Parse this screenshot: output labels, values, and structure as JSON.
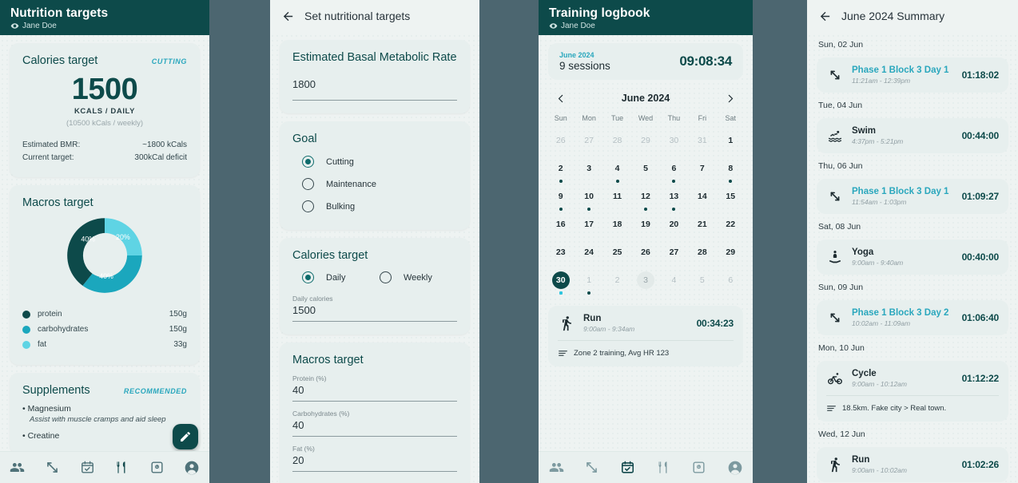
{
  "panel1": {
    "header": {
      "title": "Nutrition targets",
      "user": "Jane Doe",
      "eye_icon": "eye-icon"
    },
    "calories_card": {
      "title": "Calories target",
      "tag": "CUTTING",
      "value": "1500",
      "unit": "KCALS / DAILY",
      "weekly": "(10500 kCals / weekly)",
      "rows": [
        {
          "label": "Estimated BMR:",
          "value": "~1800 kCals"
        },
        {
          "label": "Current target:",
          "value": "300kCal deficit"
        }
      ]
    },
    "macros_card": {
      "title": "Macros target",
      "legend": [
        {
          "name": "protein",
          "value": "150g",
          "color": "#0d4a4a"
        },
        {
          "name": "carbohydrates",
          "value": "150g",
          "color": "#1ba7bd"
        },
        {
          "name": "fat",
          "value": "33g",
          "color": "#5fd4e4"
        }
      ]
    },
    "supplements_card": {
      "title": "Supplements",
      "tag": "RECOMMENDED",
      "items": [
        {
          "name": "Magnesium",
          "desc": "Assist with muscle cramps and aid sleep"
        },
        {
          "name": "Creatine",
          "desc": ""
        }
      ]
    },
    "fab": {
      "icon": "pencil-icon",
      "label": "Edit"
    },
    "nav": [
      {
        "icon": "people-icon",
        "name": "clients",
        "active": false
      },
      {
        "icon": "resize-arrows-icon",
        "name": "measurements",
        "active": false
      },
      {
        "icon": "calendar-check-icon",
        "name": "training",
        "active": false
      },
      {
        "icon": "cutlery-icon",
        "name": "nutrition",
        "active": true
      },
      {
        "icon": "scale-icon",
        "name": "weight",
        "active": false
      },
      {
        "icon": "account-icon",
        "name": "profile",
        "active": false
      }
    ]
  },
  "panel2": {
    "header": {
      "title": "Set nutritional targets",
      "back_icon": "back-arrow-icon"
    },
    "bmr_card": {
      "title": "Estimated Basal Metabolic Rate",
      "value": "1800"
    },
    "goal_card": {
      "title": "Goal",
      "options": [
        {
          "label": "Cutting",
          "selected": true
        },
        {
          "label": "Maintenance",
          "selected": false
        },
        {
          "label": "Bulking",
          "selected": false
        }
      ]
    },
    "calories_card": {
      "title": "Calories target",
      "options": [
        {
          "label": "Daily",
          "selected": true
        },
        {
          "label": "Weekly",
          "selected": false
        }
      ],
      "field_label": "Daily calories",
      "field_value": "1500"
    },
    "macros_card": {
      "title": "Macros target",
      "fields": [
        {
          "label": "Protein (%)",
          "value": "40"
        },
        {
          "label": "Carbohydrates (%)",
          "value": "40"
        },
        {
          "label": "Fat (%)",
          "value": "20"
        }
      ]
    }
  },
  "panel3": {
    "header": {
      "title": "Training logbook",
      "user": "Jane Doe",
      "eye_icon": "eye-icon"
    },
    "summary": {
      "month": "June 2024",
      "sessions": "9 sessions",
      "total_time": "09:08:34"
    },
    "calendar": {
      "month_label": "June 2024",
      "prev_icon": "chevron-left-icon",
      "next_icon": "chevron-right-icon",
      "dow": [
        "Sun",
        "Mon",
        "Tue",
        "Wed",
        "Thu",
        "Fri",
        "Sat"
      ],
      "cells": [
        {
          "n": "26",
          "state": "muted"
        },
        {
          "n": "27",
          "state": "muted"
        },
        {
          "n": "28",
          "state": "muted"
        },
        {
          "n": "29",
          "state": "muted"
        },
        {
          "n": "30",
          "state": "muted"
        },
        {
          "n": "31",
          "state": "muted"
        },
        {
          "n": "1",
          "state": "normal"
        },
        {
          "n": "2",
          "state": "normal",
          "mark": true
        },
        {
          "n": "3",
          "state": "normal"
        },
        {
          "n": "4",
          "state": "normal",
          "mark": true
        },
        {
          "n": "5",
          "state": "normal"
        },
        {
          "n": "6",
          "state": "normal",
          "mark": true
        },
        {
          "n": "7",
          "state": "normal"
        },
        {
          "n": "8",
          "state": "normal",
          "mark": true
        },
        {
          "n": "9",
          "state": "normal",
          "mark": true
        },
        {
          "n": "10",
          "state": "normal",
          "mark": true
        },
        {
          "n": "11",
          "state": "normal"
        },
        {
          "n": "12",
          "state": "normal",
          "mark": true
        },
        {
          "n": "13",
          "state": "normal",
          "mark": true
        },
        {
          "n": "14",
          "state": "normal"
        },
        {
          "n": "15",
          "state": "normal"
        },
        {
          "n": "16",
          "state": "normal"
        },
        {
          "n": "17",
          "state": "normal"
        },
        {
          "n": "18",
          "state": "normal"
        },
        {
          "n": "19",
          "state": "normal"
        },
        {
          "n": "20",
          "state": "normal"
        },
        {
          "n": "21",
          "state": "normal"
        },
        {
          "n": "22",
          "state": "normal"
        },
        {
          "n": "23",
          "state": "normal"
        },
        {
          "n": "24",
          "state": "normal"
        },
        {
          "n": "25",
          "state": "normal"
        },
        {
          "n": "26",
          "state": "normal"
        },
        {
          "n": "27",
          "state": "normal"
        },
        {
          "n": "28",
          "state": "normal"
        },
        {
          "n": "29",
          "state": "normal"
        },
        {
          "n": "30",
          "state": "selected",
          "mark_light": true
        },
        {
          "n": "1",
          "state": "muted",
          "mark": true
        },
        {
          "n": "2",
          "state": "muted"
        },
        {
          "n": "3",
          "state": "today"
        },
        {
          "n": "4",
          "state": "muted"
        },
        {
          "n": "5",
          "state": "muted"
        },
        {
          "n": "6",
          "state": "muted"
        }
      ]
    },
    "session": {
      "icon": "run-icon",
      "name": "Run",
      "when": "9:00am - 9:34am",
      "duration": "00:34:23",
      "note_icon": "notes-icon",
      "note": "Zone 2 training, Avg HR 123"
    },
    "nav": [
      {
        "icon": "people-icon",
        "name": "clients",
        "active": false
      },
      {
        "icon": "resize-arrows-icon",
        "name": "measurements",
        "active": false
      },
      {
        "icon": "calendar-check-icon",
        "name": "training",
        "active": true
      },
      {
        "icon": "cutlery-icon",
        "name": "nutrition",
        "active": false
      },
      {
        "icon": "scale-icon",
        "name": "weight",
        "active": false
      },
      {
        "icon": "account-icon",
        "name": "profile",
        "active": false
      }
    ]
  },
  "panel4": {
    "header": {
      "title": "June 2024 Summary",
      "back_icon": "back-arrow-icon"
    },
    "days": [
      {
        "label": "Sun, 02 Jun",
        "entries": [
          {
            "icon": "dumbbell-icon",
            "name": "Phase 1 Block 3 Day 1",
            "link": true,
            "when": "11:21am - 12:39pm",
            "duration": "01:18:02",
            "note": ""
          }
        ]
      },
      {
        "label": "Tue, 04 Jun",
        "entries": [
          {
            "icon": "swim-icon",
            "name": "Swim",
            "link": false,
            "when": "4:37pm - 5:21pm",
            "duration": "00:44:00",
            "note": ""
          }
        ]
      },
      {
        "label": "Thu, 06 Jun",
        "entries": [
          {
            "icon": "dumbbell-icon",
            "name": "Phase 1 Block 3 Day 1",
            "link": true,
            "when": "11:54am - 1:03pm",
            "duration": "01:09:27",
            "note": ""
          }
        ]
      },
      {
        "label": "Sat, 08 Jun",
        "entries": [
          {
            "icon": "yoga-icon",
            "name": "Yoga",
            "link": false,
            "when": "9:00am - 9:40am",
            "duration": "00:40:00",
            "note": ""
          }
        ]
      },
      {
        "label": "Sun, 09 Jun",
        "entries": [
          {
            "icon": "dumbbell-icon",
            "name": "Phase 1 Block 3 Day 2",
            "link": true,
            "when": "10:02am - 11:09am",
            "duration": "01:06:40",
            "note": ""
          }
        ]
      },
      {
        "label": "Mon, 10 Jun",
        "entries": [
          {
            "icon": "cycle-icon",
            "name": "Cycle",
            "link": false,
            "when": "9:00am - 10:12am",
            "duration": "01:12:22",
            "note": "18.5km. Fake city > Real town."
          }
        ]
      },
      {
        "label": "Wed, 12 Jun",
        "entries": [
          {
            "icon": "run-icon",
            "name": "Run",
            "link": false,
            "when": "9:00am - 10:02am",
            "duration": "01:02:26",
            "note": ""
          }
        ]
      }
    ]
  },
  "chart_data": {
    "type": "pie",
    "title": "Macros target",
    "categories": [
      "protein",
      "carbohydrates",
      "fat"
    ],
    "values": [
      40,
      40,
      20
    ],
    "labels": [
      "40%",
      "40%",
      "20%"
    ],
    "grams": [
      "150g",
      "150g",
      "33g"
    ],
    "colors": [
      "#0d4a4a",
      "#1ba7bd",
      "#5fd4e4"
    ],
    "donut": true,
    "legend": "bottom"
  },
  "theme": {
    "dark_teal": "#0d4a4a",
    "accent_cyan": "#2aa7bd",
    "panel_bg": "#eef3f2",
    "card_bg": "#e7efee",
    "gap_bg": "#4c6670"
  }
}
